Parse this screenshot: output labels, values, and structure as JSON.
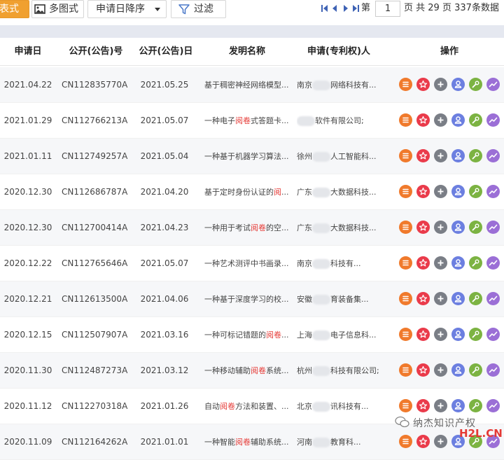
{
  "toolbar": {
    "list_view_label": "列表式",
    "multi_view_label": "多图式",
    "sort_label": "申请日降序",
    "filter_label": "过滤"
  },
  "pager": {
    "page_prefix": "第",
    "current_page": "1",
    "page_suffix": "页 共",
    "total_pages": "29",
    "pages_word": "页",
    "total_records": "337",
    "records_word": "条数据"
  },
  "table": {
    "headers": [
      "申请日",
      "公开(公告)号",
      "公开(公告)日",
      "发明名称",
      "申请(专利权)人",
      "操作"
    ],
    "rows": [
      {
        "date": "2021.04.22",
        "pub_no": "CN112835770A",
        "pub_date": "2021.05.25",
        "title_pre": "基于稠密神经网络模型...",
        "title_hl": "",
        "title_post": "",
        "app_pre": "南京",
        "app_post": "网络科技有..."
      },
      {
        "date": "2021.01.29",
        "pub_no": "CN112766213A",
        "pub_date": "2021.05.07",
        "title_pre": "一种电子",
        "title_hl": "阅卷",
        "title_post": "式答题卡...",
        "app_pre": "",
        "app_post": "软件有限公司;"
      },
      {
        "date": "2021.01.11",
        "pub_no": "CN112749257A",
        "pub_date": "2021.05.04",
        "title_pre": "一种基于机器学习算法...",
        "title_hl": "",
        "title_post": "",
        "app_pre": "徐州",
        "app_post": "人工智能科..."
      },
      {
        "date": "2020.12.30",
        "pub_no": "CN112686787A",
        "pub_date": "2021.04.20",
        "title_pre": "基于定时身份认证的",
        "title_hl": "阅",
        "title_post": "...",
        "app_pre": "广东",
        "app_post": "大数据科技..."
      },
      {
        "date": "2020.12.30",
        "pub_no": "CN112700414A",
        "pub_date": "2021.04.23",
        "title_pre": "一种用于考试",
        "title_hl": "阅卷",
        "title_post": "的空...",
        "app_pre": "广东",
        "app_post": "大数据科技..."
      },
      {
        "date": "2020.12.22",
        "pub_no": "CN112765646A",
        "pub_date": "2021.05.07",
        "title_pre": "一种艺术测评中书画录...",
        "title_hl": "",
        "title_post": "",
        "app_pre": "南京",
        "app_post": "科技有..."
      },
      {
        "date": "2020.12.21",
        "pub_no": "CN112613500A",
        "pub_date": "2021.04.06",
        "title_pre": "一种基于深度学习的校...",
        "title_hl": "",
        "title_post": "",
        "app_pre": "安徽",
        "app_post": "育装备集..."
      },
      {
        "date": "2020.12.15",
        "pub_no": "CN112507907A",
        "pub_date": "2021.03.16",
        "title_pre": "一种可标记错题的",
        "title_hl": "阅卷",
        "title_post": "...",
        "app_pre": "上海",
        "app_post": "电子信息科..."
      },
      {
        "date": "2020.11.30",
        "pub_no": "CN112487273A",
        "pub_date": "2021.03.12",
        "title_pre": "一种移动辅助",
        "title_hl": "阅卷",
        "title_post": "系统...",
        "app_pre": "杭州",
        "app_post": "科技有限公司;"
      },
      {
        "date": "2020.11.12",
        "pub_no": "CN112270318A",
        "pub_date": "2021.01.26",
        "title_pre": "自动",
        "title_hl": "阅卷",
        "title_post": "方法和装置、...",
        "app_pre": "北京",
        "app_post": "讯科技有..."
      },
      {
        "date": "2020.11.09",
        "pub_no": "CN112164262A",
        "pub_date": "2021.01.01",
        "title_pre": "一种智能",
        "title_hl": "阅卷",
        "title_post": "辅助系统...",
        "app_pre": "河南",
        "app_post": "教育科..."
      }
    ]
  },
  "watermark": {
    "text": "纳杰知识产权",
    "logo": "H2L.CN"
  },
  "colors": {
    "toolbar_active": "#f0a030",
    "highlight": "#e53935",
    "op_list": "#f07a2c",
    "op_star": "#ea3b4b",
    "op_add": "#7a7e86",
    "op_user": "#6c7fe0",
    "op_tool": "#7cb342",
    "op_trend": "#9b6fd6"
  }
}
